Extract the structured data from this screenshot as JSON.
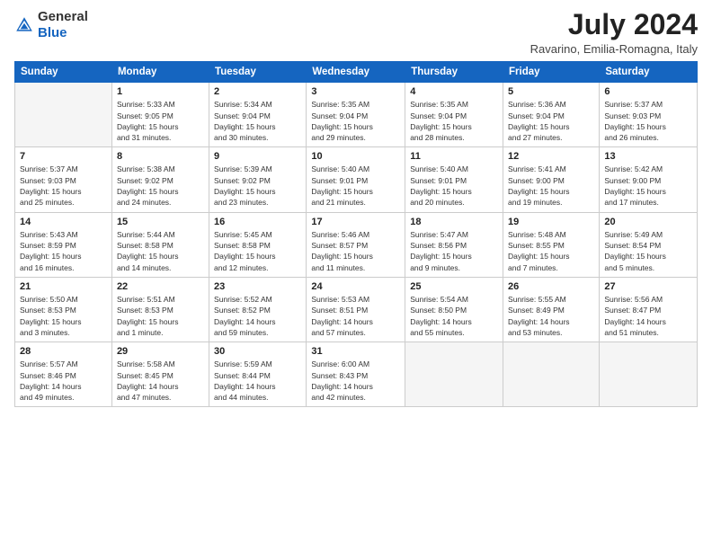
{
  "header": {
    "logo_general": "General",
    "logo_blue": "Blue",
    "title": "July 2024",
    "location": "Ravarino, Emilia-Romagna, Italy"
  },
  "days_of_week": [
    "Sunday",
    "Monday",
    "Tuesday",
    "Wednesday",
    "Thursday",
    "Friday",
    "Saturday"
  ],
  "weeks": [
    [
      {
        "num": "",
        "info": ""
      },
      {
        "num": "1",
        "info": "Sunrise: 5:33 AM\nSunset: 9:05 PM\nDaylight: 15 hours\nand 31 minutes."
      },
      {
        "num": "2",
        "info": "Sunrise: 5:34 AM\nSunset: 9:04 PM\nDaylight: 15 hours\nand 30 minutes."
      },
      {
        "num": "3",
        "info": "Sunrise: 5:35 AM\nSunset: 9:04 PM\nDaylight: 15 hours\nand 29 minutes."
      },
      {
        "num": "4",
        "info": "Sunrise: 5:35 AM\nSunset: 9:04 PM\nDaylight: 15 hours\nand 28 minutes."
      },
      {
        "num": "5",
        "info": "Sunrise: 5:36 AM\nSunset: 9:04 PM\nDaylight: 15 hours\nand 27 minutes."
      },
      {
        "num": "6",
        "info": "Sunrise: 5:37 AM\nSunset: 9:03 PM\nDaylight: 15 hours\nand 26 minutes."
      }
    ],
    [
      {
        "num": "7",
        "info": "Sunrise: 5:37 AM\nSunset: 9:03 PM\nDaylight: 15 hours\nand 25 minutes."
      },
      {
        "num": "8",
        "info": "Sunrise: 5:38 AM\nSunset: 9:02 PM\nDaylight: 15 hours\nand 24 minutes."
      },
      {
        "num": "9",
        "info": "Sunrise: 5:39 AM\nSunset: 9:02 PM\nDaylight: 15 hours\nand 23 minutes."
      },
      {
        "num": "10",
        "info": "Sunrise: 5:40 AM\nSunset: 9:01 PM\nDaylight: 15 hours\nand 21 minutes."
      },
      {
        "num": "11",
        "info": "Sunrise: 5:40 AM\nSunset: 9:01 PM\nDaylight: 15 hours\nand 20 minutes."
      },
      {
        "num": "12",
        "info": "Sunrise: 5:41 AM\nSunset: 9:00 PM\nDaylight: 15 hours\nand 19 minutes."
      },
      {
        "num": "13",
        "info": "Sunrise: 5:42 AM\nSunset: 9:00 PM\nDaylight: 15 hours\nand 17 minutes."
      }
    ],
    [
      {
        "num": "14",
        "info": "Sunrise: 5:43 AM\nSunset: 8:59 PM\nDaylight: 15 hours\nand 16 minutes."
      },
      {
        "num": "15",
        "info": "Sunrise: 5:44 AM\nSunset: 8:58 PM\nDaylight: 15 hours\nand 14 minutes."
      },
      {
        "num": "16",
        "info": "Sunrise: 5:45 AM\nSunset: 8:58 PM\nDaylight: 15 hours\nand 12 minutes."
      },
      {
        "num": "17",
        "info": "Sunrise: 5:46 AM\nSunset: 8:57 PM\nDaylight: 15 hours\nand 11 minutes."
      },
      {
        "num": "18",
        "info": "Sunrise: 5:47 AM\nSunset: 8:56 PM\nDaylight: 15 hours\nand 9 minutes."
      },
      {
        "num": "19",
        "info": "Sunrise: 5:48 AM\nSunset: 8:55 PM\nDaylight: 15 hours\nand 7 minutes."
      },
      {
        "num": "20",
        "info": "Sunrise: 5:49 AM\nSunset: 8:54 PM\nDaylight: 15 hours\nand 5 minutes."
      }
    ],
    [
      {
        "num": "21",
        "info": "Sunrise: 5:50 AM\nSunset: 8:53 PM\nDaylight: 15 hours\nand 3 minutes."
      },
      {
        "num": "22",
        "info": "Sunrise: 5:51 AM\nSunset: 8:53 PM\nDaylight: 15 hours\nand 1 minute."
      },
      {
        "num": "23",
        "info": "Sunrise: 5:52 AM\nSunset: 8:52 PM\nDaylight: 14 hours\nand 59 minutes."
      },
      {
        "num": "24",
        "info": "Sunrise: 5:53 AM\nSunset: 8:51 PM\nDaylight: 14 hours\nand 57 minutes."
      },
      {
        "num": "25",
        "info": "Sunrise: 5:54 AM\nSunset: 8:50 PM\nDaylight: 14 hours\nand 55 minutes."
      },
      {
        "num": "26",
        "info": "Sunrise: 5:55 AM\nSunset: 8:49 PM\nDaylight: 14 hours\nand 53 minutes."
      },
      {
        "num": "27",
        "info": "Sunrise: 5:56 AM\nSunset: 8:47 PM\nDaylight: 14 hours\nand 51 minutes."
      }
    ],
    [
      {
        "num": "28",
        "info": "Sunrise: 5:57 AM\nSunset: 8:46 PM\nDaylight: 14 hours\nand 49 minutes."
      },
      {
        "num": "29",
        "info": "Sunrise: 5:58 AM\nSunset: 8:45 PM\nDaylight: 14 hours\nand 47 minutes."
      },
      {
        "num": "30",
        "info": "Sunrise: 5:59 AM\nSunset: 8:44 PM\nDaylight: 14 hours\nand 44 minutes."
      },
      {
        "num": "31",
        "info": "Sunrise: 6:00 AM\nSunset: 8:43 PM\nDaylight: 14 hours\nand 42 minutes."
      },
      {
        "num": "",
        "info": ""
      },
      {
        "num": "",
        "info": ""
      },
      {
        "num": "",
        "info": ""
      }
    ]
  ]
}
